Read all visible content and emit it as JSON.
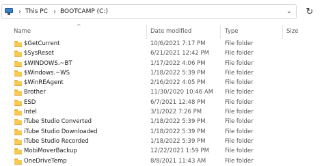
{
  "address_bar": {
    "breadcrumbs": [
      "This PC",
      "BOOTCAMP (C:)"
    ],
    "separator": "›",
    "chevron": "⌄",
    "refresh_glyph": "↻"
  },
  "columns": {
    "name": "Name",
    "date_modified": "Date modified",
    "type": "Type",
    "size": "Size",
    "sort_indicator": "^"
  },
  "rows": [
    {
      "name": "$GetCurrent",
      "date": "10/6/2021 7:17 PM",
      "type": "File folder"
    },
    {
      "name": "$SysReset",
      "date": "6/21/2021 12:42 PM",
      "type": "File folder"
    },
    {
      "name": "$WINDOWS.~BT",
      "date": "1/17/2022 4:06 PM",
      "type": "File folder"
    },
    {
      "name": "$Windows.~WS",
      "date": "1/18/2022 5:39 PM",
      "type": "File folder"
    },
    {
      "name": "$WinREAgent",
      "date": "2/16/2022 4:05 PM",
      "type": "File folder"
    },
    {
      "name": "Brother",
      "date": "11/30/2020 10:46 AM",
      "type": "File folder"
    },
    {
      "name": "ESD",
      "date": "6/7/2021 12:48 PM",
      "type": "File folder"
    },
    {
      "name": "Intel",
      "date": "3/1/2022 7:26 PM",
      "type": "File folder"
    },
    {
      "name": "iTube Studio Converted",
      "date": "1/18/2022 5:39 PM",
      "type": "File folder"
    },
    {
      "name": "iTube Studio Downloaded",
      "date": "1/18/2022 5:39 PM",
      "type": "File folder"
    },
    {
      "name": "iTube Studio Recorded",
      "date": "1/18/2022 5:39 PM",
      "type": "File folder"
    },
    {
      "name": "MobiMoverBackup",
      "date": "12/22/2021 1:59 PM",
      "type": "File folder"
    },
    {
      "name": "OneDriveTemp",
      "date": "8/8/2021 11:43 AM",
      "type": "File folder"
    }
  ],
  "colors": {
    "folder": "#f8c955",
    "accent": "#3a7fc7"
  }
}
